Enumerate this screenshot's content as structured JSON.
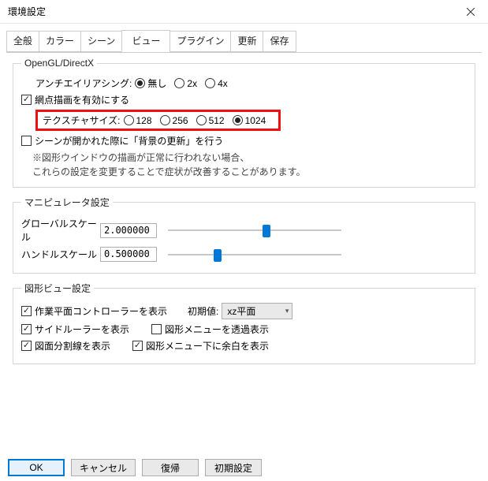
{
  "window": {
    "title": "環境設定"
  },
  "tabs": [
    "全般",
    "カラー",
    "シーン",
    "ビュー",
    "プラグイン",
    "更新",
    "保存"
  ],
  "activeTab": "ビュー",
  "group1": {
    "legend": "OpenGL/DirectX",
    "aa_label": "アンチエイリアシング:",
    "aa_options": [
      "無し",
      "2x",
      "4x"
    ],
    "aa_selected": "無し",
    "halftone_label": "網点描画を有効にする",
    "tex_label": "テクスチャサイズ:",
    "tex_options": [
      "128",
      "256",
      "512",
      "1024"
    ],
    "tex_selected": "1024",
    "bgupdate_label": "シーンが開かれた際に「背景の更新」を行う",
    "note1": "※図形ウインドウの描画が正常に行われない場合、",
    "note2": "これらの設定を変更することで症状が改善することがあります。"
  },
  "group2": {
    "legend": "マニピュレータ設定",
    "global_label": "グローバルスケール",
    "global_value": "2.000000",
    "handle_label": "ハンドルスケール",
    "handle_value": "0.500000"
  },
  "group3": {
    "legend": "図形ビュー設定",
    "workplane_label": "作業平面コントローラーを表示",
    "init_label": "初期値:",
    "init_value": "xz平面",
    "siderulers_label": "サイドルーラーを表示",
    "transmenu_label": "図形メニューを透過表示",
    "divlines_label": "図面分割線を表示",
    "margin_label": "図形メニュー下に余白を表示"
  },
  "buttons": {
    "ok": "OK",
    "cancel": "キャンセル",
    "revert": "復帰",
    "defaults": "初期設定"
  }
}
